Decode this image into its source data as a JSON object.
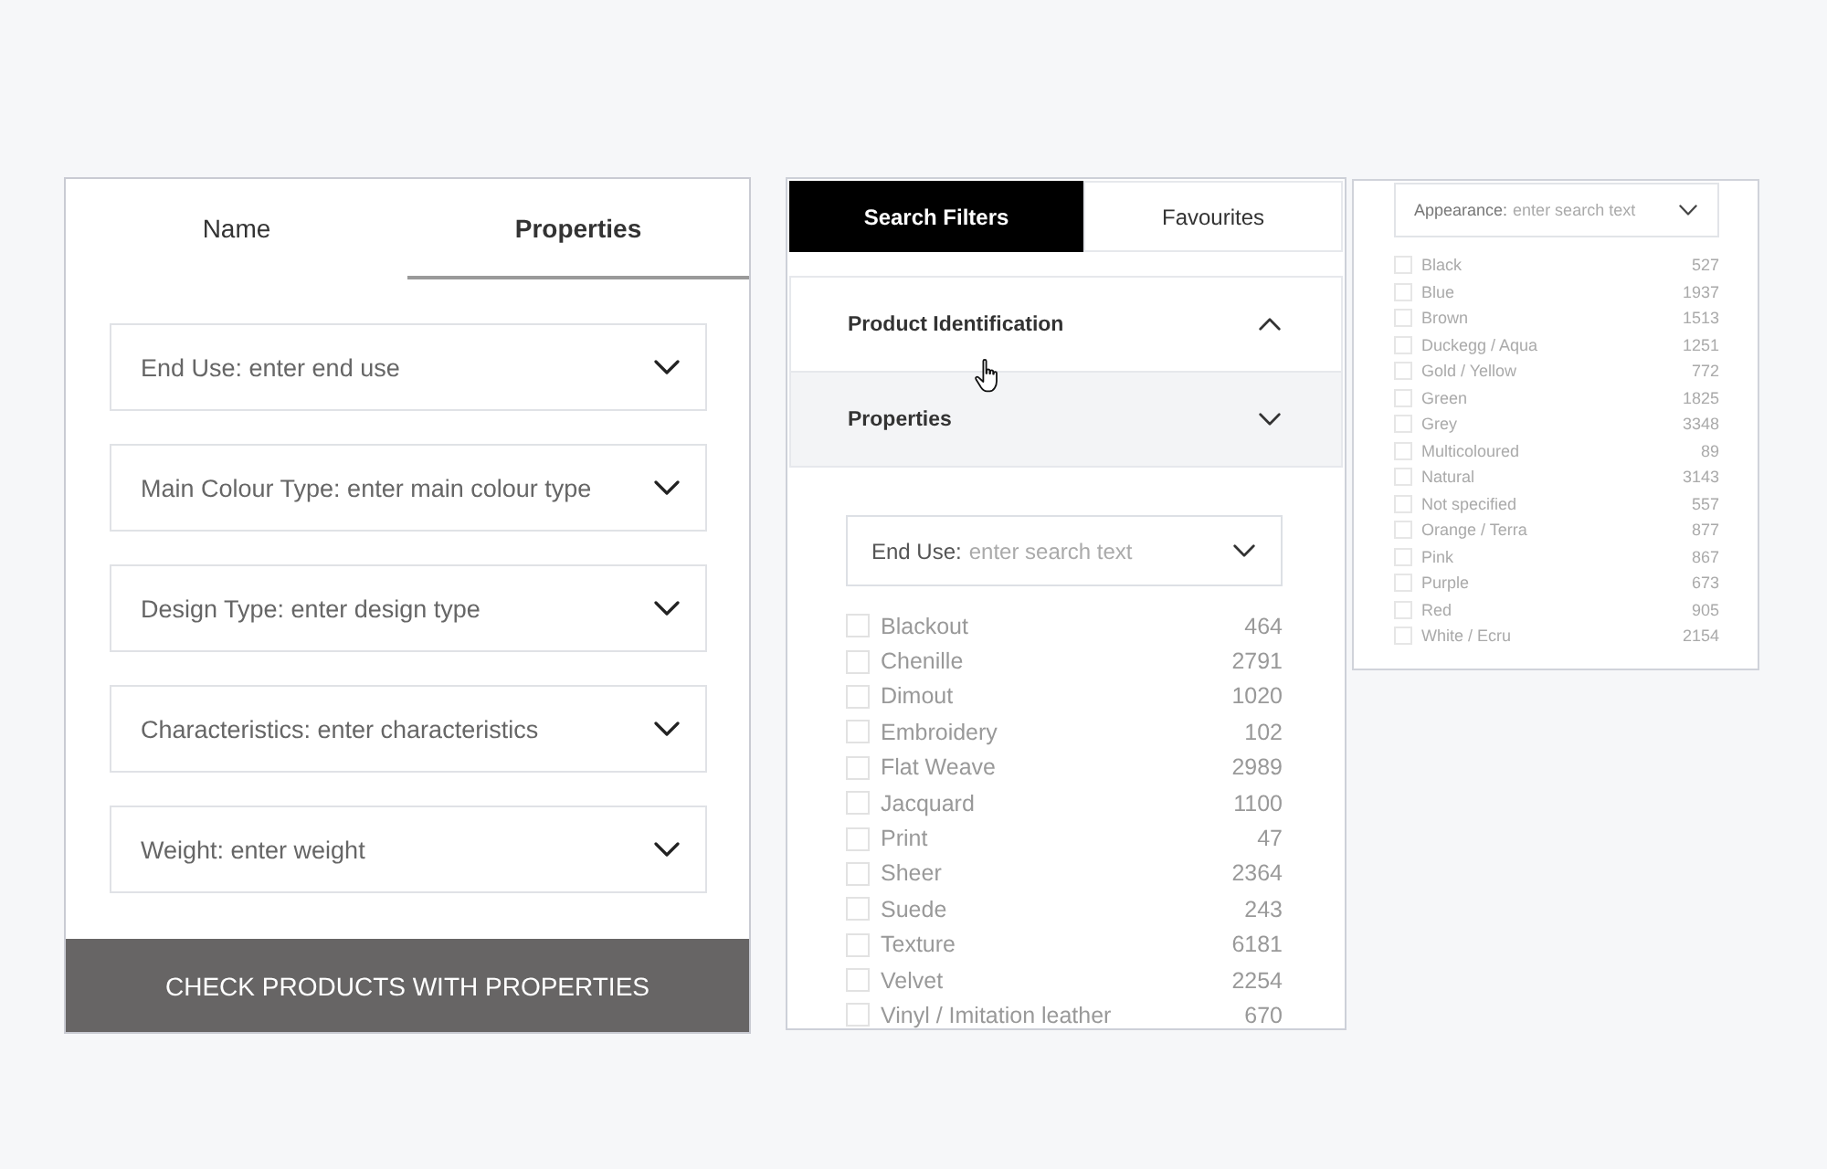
{
  "property_panel": {
    "tabs": [
      {
        "label": "Name",
        "selected": false
      },
      {
        "label": "Properties",
        "selected": true
      }
    ],
    "dropdowns": [
      {
        "placeholder": "End Use: enter end use"
      },
      {
        "placeholder": "Main Colour Type: enter main colour type"
      },
      {
        "placeholder": "Design Type: enter design type"
      },
      {
        "placeholder": "Characteristics: enter characteristics"
      },
      {
        "placeholder": "Weight: enter weight"
      }
    ],
    "button": "CHECK PRODUCTS WITH PROPERTIES"
  },
  "filter_panel": {
    "tabs": [
      {
        "label": "Search Filters",
        "selected": true
      },
      {
        "label": "Favourites",
        "selected": false
      }
    ],
    "sections": [
      {
        "title": "Product Identification",
        "expanded": true,
        "highlighted": false
      },
      {
        "title": "Properties",
        "expanded": false,
        "highlighted": true
      }
    ],
    "dropdown": {
      "label": "End Use:",
      "placeholder": "enter search text"
    },
    "options": [
      {
        "label": "Blackout",
        "count": "464",
        "checked": false
      },
      {
        "label": "Chenille",
        "count": "2791",
        "checked": false
      },
      {
        "label": "Dimout",
        "count": "1020",
        "checked": false
      },
      {
        "label": "Embroidery",
        "count": "102",
        "checked": false
      },
      {
        "label": "Flat Weave",
        "count": "2989",
        "checked": false
      },
      {
        "label": "Jacquard",
        "count": "1100",
        "checked": false
      },
      {
        "label": "Print",
        "count": "47",
        "checked": false
      },
      {
        "label": "Sheer",
        "count": "2364",
        "checked": false
      },
      {
        "label": "Suede",
        "count": "243",
        "checked": false
      },
      {
        "label": "Texture",
        "count": "6181",
        "checked": false
      },
      {
        "label": "Velvet",
        "count": "2254",
        "checked": false
      },
      {
        "label": "Vinyl / Imitation leather",
        "count": "670",
        "checked": false
      }
    ]
  },
  "appearance_panel": {
    "dropdown": {
      "label": "Appearance:",
      "placeholder": "enter search text"
    },
    "options": [
      {
        "label": "Black",
        "count": "527",
        "checked": false
      },
      {
        "label": "Blue",
        "count": "1937",
        "checked": false
      },
      {
        "label": "Brown",
        "count": "1513",
        "checked": false
      },
      {
        "label": "Duckegg / Aqua",
        "count": "1251",
        "checked": false
      },
      {
        "label": "Gold / Yellow",
        "count": "772",
        "checked": false
      },
      {
        "label": "Green",
        "count": "1825",
        "checked": false
      },
      {
        "label": "Grey",
        "count": "3348",
        "checked": false
      },
      {
        "label": "Multicoloured",
        "count": "89",
        "checked": false
      },
      {
        "label": "Natural",
        "count": "3143",
        "checked": false
      },
      {
        "label": "Not specified",
        "count": "557",
        "checked": false
      },
      {
        "label": "Orange / Terra",
        "count": "877",
        "checked": false
      },
      {
        "label": "Pink",
        "count": "867",
        "checked": false
      },
      {
        "label": "Purple",
        "count": "673",
        "checked": false
      },
      {
        "label": "Red",
        "count": "905",
        "checked": false
      },
      {
        "label": "White / Ecru",
        "count": "2154",
        "checked": false
      }
    ]
  }
}
